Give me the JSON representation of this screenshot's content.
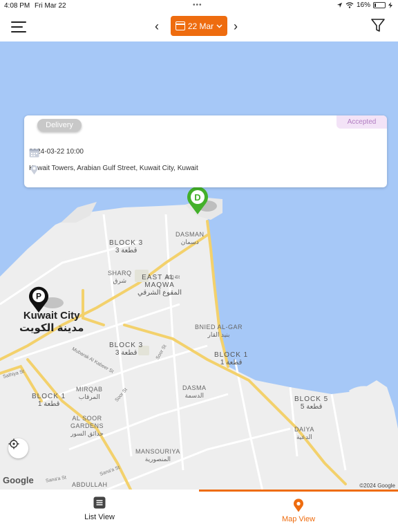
{
  "status_bar": {
    "time": "4:08 PM",
    "date": "Fri Mar 22",
    "battery": "16%",
    "battery_level": 0.16
  },
  "header": {
    "date_label": "22 Mar",
    "prev_glyph": "‹",
    "next_glyph": "›"
  },
  "order_card": {
    "type_chip": "Delivery",
    "status": "Accepted",
    "datetime": "2024-03-22 10:00",
    "address": "Kuwait Towers, Arabian Gulf Street, Kuwait City, Kuwait"
  },
  "pins": {
    "delivery_letter": "D",
    "pickup_letter": "P"
  },
  "map": {
    "city_en": "Kuwait City",
    "city_ar": "مدينة الكويت",
    "labels": [
      {
        "en": "BLOCK 3",
        "ar": "قطعة 3"
      },
      {
        "en": "DASMAN",
        "ar": "دسمان"
      },
      {
        "en": "SHARQ",
        "ar": "شرق"
      },
      {
        "en": "EAST AL-MAQWA",
        "ar": "المقوع الشرقي"
      },
      {
        "en": "BNIED AL-GAR",
        "ar": "بنيد القار"
      },
      {
        "en": "BLOCK 3",
        "ar": "قطعة 3"
      },
      {
        "en": "BLOCK 1",
        "ar": "قطعة 1"
      },
      {
        "en": "DASMA",
        "ar": "الدسمة"
      },
      {
        "en": "MIRQAB",
        "ar": "المرقاب"
      },
      {
        "en": "BLOCK 1",
        "ar": "قطعة 1"
      },
      {
        "en": "BLOCK 5",
        "ar": "قطعة 5"
      },
      {
        "en": "AL SOOR GARDENS",
        "ar": "حدائق السور"
      },
      {
        "en": "DAIYA",
        "ar": "الدعية"
      },
      {
        "en": "MANSOURIYA",
        "ar": "المنصورية"
      },
      {
        "en": "ABDULLAH",
        "ar": ""
      }
    ],
    "streets": [
      "800 St",
      "Mubarak Al Kabeer St",
      "Soor St",
      "Sana'a St",
      "Salhiya St",
      "Sana'a St",
      "Soor St"
    ],
    "google": "Google",
    "copyright": "©2024 Google"
  },
  "tabs": {
    "list_label": "List View",
    "map_label": "Map View"
  },
  "colors": {
    "accent": "#ee6c0f",
    "delivery_pin": "#43b02a",
    "pickup_pin": "#111111",
    "water": "#a6c8f7",
    "land": "#eeeeee"
  }
}
